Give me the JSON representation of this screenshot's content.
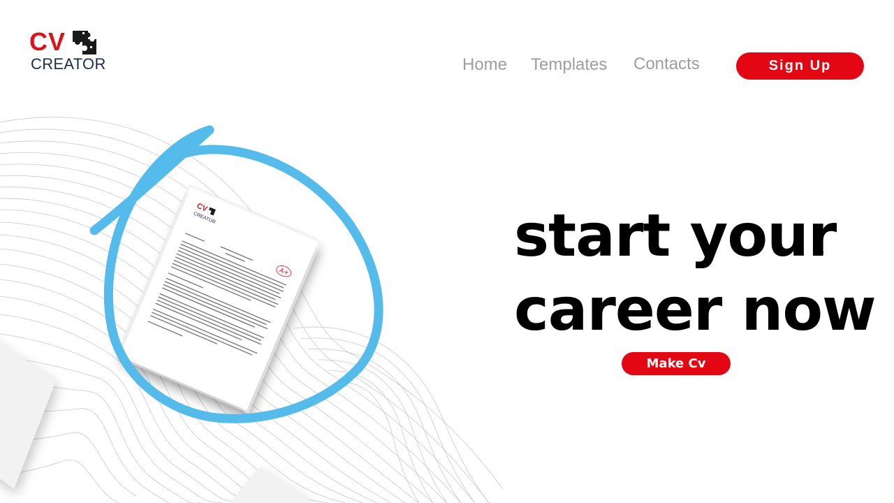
{
  "brand": {
    "logo_main": "CV",
    "logo_sub": "CREATOR",
    "accent_color": "#e30613",
    "navy_color": "#1e2b45",
    "logo_icon": "puzzle-icon"
  },
  "nav": {
    "home": "Home",
    "templates": "Templates",
    "contacts": "Contacts",
    "signup": "Sign Up"
  },
  "hero": {
    "line1": "start your",
    "dots": "..",
    "line2": "career now",
    "cta": "Make Cv"
  },
  "illustration": {
    "doc_brand_main": "CV",
    "doc_brand_sub": "CREATOR",
    "grade": "A+",
    "highlight_color": "#55bbea",
    "description_icon": "resume-document-icon"
  }
}
